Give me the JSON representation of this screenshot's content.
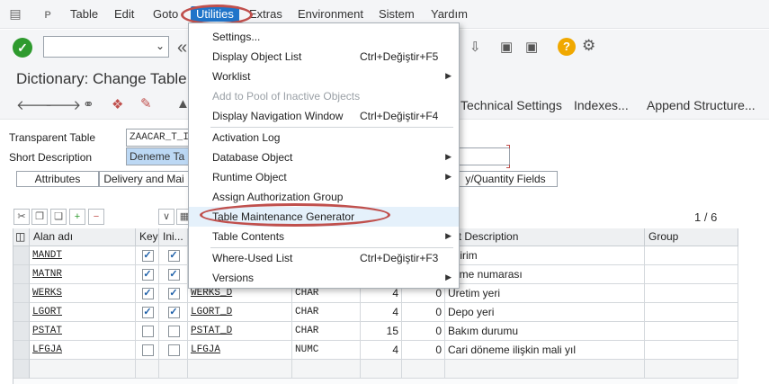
{
  "menubar": {
    "items": [
      "Table",
      "Edit",
      "Goto",
      "Utilities",
      "Extras",
      "Environment",
      "Sistem",
      "Yardım"
    ]
  },
  "title": "Dictionary: Change Table",
  "app_toolbar": {
    "technical_settings": "Technical Settings",
    "indexes": "Indexes...",
    "append_structure": "Append Structure..."
  },
  "header": {
    "transparent_table_label": "Transparent Table",
    "transparent_table_value": "ZAACAR_T_I",
    "short_description_label": "Short Description",
    "short_description_value": "Deneme Ta"
  },
  "tabs": [
    "Attributes",
    "Delivery and Mai",
    "y/Quantity Fields"
  ],
  "counter": "1 / 6",
  "grid": {
    "columns": [
      "Alan adı",
      "Key",
      "Ini...",
      "",
      "",
      "",
      "",
      "ort Description",
      "Group"
    ],
    "rows": [
      {
        "field": "MANDT",
        "key": true,
        "init": true,
        "element": "",
        "type": "",
        "len": "",
        "dec": "",
        "desc": "t birim"
      },
      {
        "field": "MATNR",
        "key": true,
        "init": true,
        "element": "",
        "type": "",
        "len": "",
        "dec": "",
        "desc": "zeme numarası"
      },
      {
        "field": "WERKS",
        "key": true,
        "init": true,
        "element": "WERKS_D",
        "type": "CHAR",
        "len": "4",
        "dec": "0",
        "desc": "Üretim yeri"
      },
      {
        "field": "LGORT",
        "key": true,
        "init": true,
        "element": "LGORT_D",
        "type": "CHAR",
        "len": "4",
        "dec": "0",
        "desc": "Depo yeri"
      },
      {
        "field": "PSTAT",
        "key": false,
        "init": false,
        "element": "PSTAT_D",
        "type": "CHAR",
        "len": "15",
        "dec": "0",
        "desc": "Bakım durumu"
      },
      {
        "field": "LFGJA",
        "key": false,
        "init": false,
        "element": "LFGJA",
        "type": "NUMC",
        "len": "4",
        "dec": "0",
        "desc": "Cari döneme ilişkin mali yıl"
      }
    ]
  },
  "utilities_menu": {
    "items": [
      {
        "label": "Settings...",
        "shortcut": "",
        "submenu": false,
        "disabled": false
      },
      {
        "label": "Display Object List",
        "shortcut": "Ctrl+Değiştir+F5",
        "submenu": false,
        "disabled": false
      },
      {
        "label": "Worklist",
        "shortcut": "",
        "submenu": true,
        "disabled": false
      },
      {
        "label": "Add to Pool of Inactive Objects",
        "shortcut": "",
        "submenu": false,
        "disabled": true
      },
      {
        "label": "Display Navigation Window",
        "shortcut": "Ctrl+Değiştir+F4",
        "submenu": false,
        "disabled": false
      },
      {
        "label": "Activation Log",
        "shortcut": "",
        "submenu": false,
        "disabled": false
      },
      {
        "label": "Database Object",
        "shortcut": "",
        "submenu": true,
        "disabled": false
      },
      {
        "label": "Runtime Object",
        "shortcut": "",
        "submenu": true,
        "disabled": false
      },
      {
        "label": "Assign Authorization Group",
        "shortcut": "",
        "submenu": false,
        "disabled": false
      },
      {
        "label": "Table Maintenance Generator",
        "shortcut": "",
        "submenu": false,
        "disabled": false
      },
      {
        "label": "Table Contents",
        "shortcut": "",
        "submenu": true,
        "disabled": false
      },
      {
        "label": "Where-Used List",
        "shortcut": "Ctrl+Değiştir+F3",
        "submenu": false,
        "disabled": false
      },
      {
        "label": "Versions",
        "shortcut": "",
        "submenu": true,
        "disabled": false
      }
    ]
  },
  "colors": {
    "highlight_oval": "#c0504d",
    "menu_selected": "#1f74c9",
    "ok_green": "#2e9a2e",
    "help_yellow": "#f0a800"
  },
  "icons": [
    "system-menu-icon",
    "layout-icon",
    "ok-check-icon",
    "back-arrow-icon",
    "forward-arrow-icon",
    "glasses-icon",
    "help-icon",
    "settings-gear-icon",
    "submenu-arrow-icon"
  ]
}
